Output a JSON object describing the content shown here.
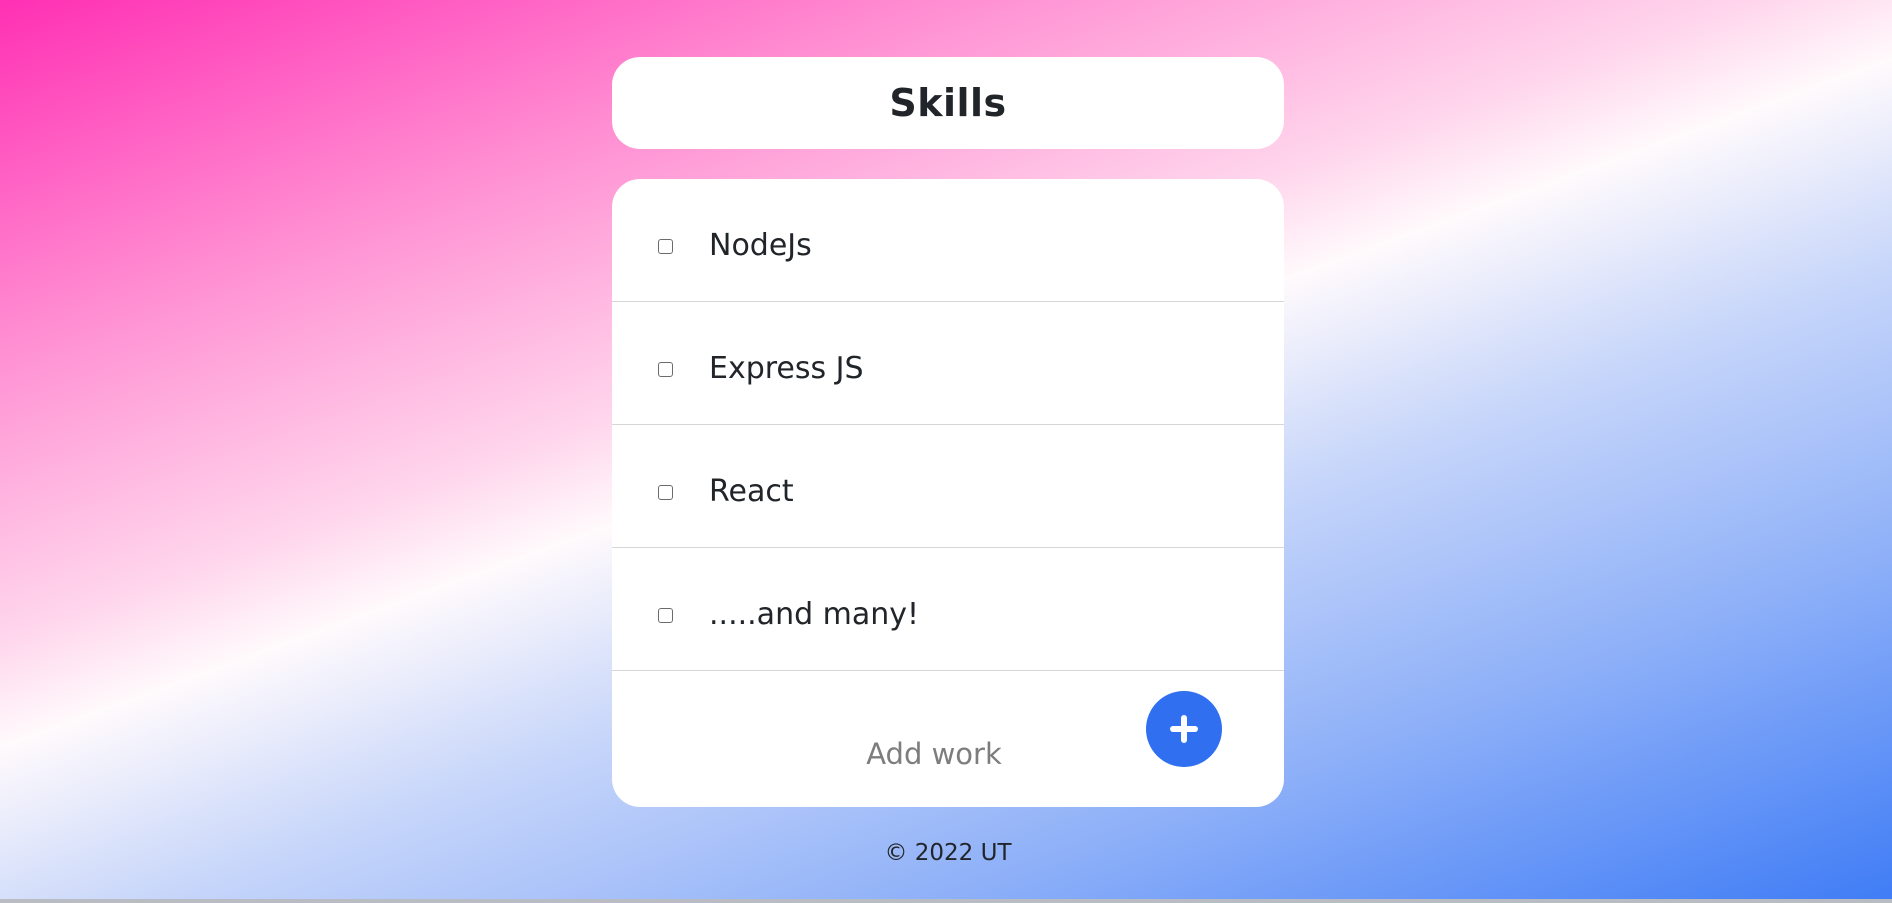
{
  "header": {
    "title": "Skills"
  },
  "items": [
    {
      "label": "NodeJs",
      "checked": false
    },
    {
      "label": "Express JS",
      "checked": false
    },
    {
      "label": "React",
      "checked": false
    },
    {
      "label": ".....and many!",
      "checked": false
    }
  ],
  "add": {
    "placeholder": "Add work",
    "value": "",
    "button_icon": "plus-icon"
  },
  "footer": {
    "text": "© 2022 UT"
  },
  "colors": {
    "accent": "#2f6ff0",
    "card": "#ffffff",
    "text": "#212529",
    "gradient_start": "#ff30b4",
    "gradient_end": "#3f7cf6"
  }
}
